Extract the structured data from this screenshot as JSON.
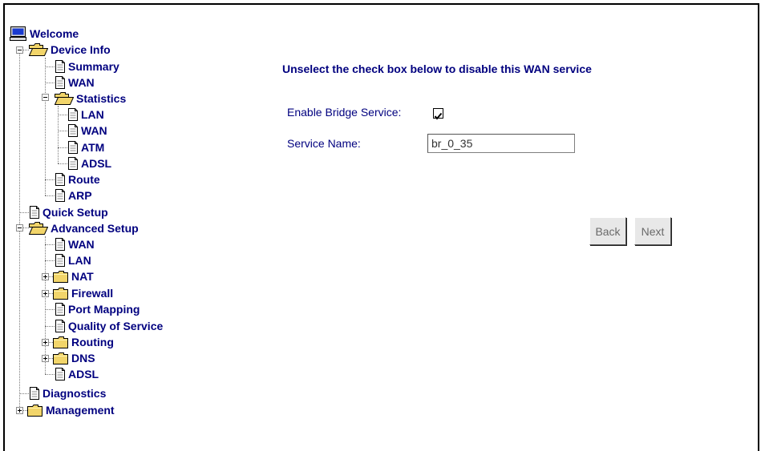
{
  "tree": {
    "welcome": "Welcome",
    "device_info": "Device Info",
    "summary": "Summary",
    "wan": "WAN",
    "statistics": "Statistics",
    "stat_lan": "LAN",
    "stat_wan": "WAN",
    "stat_atm": "ATM",
    "stat_adsl": "ADSL",
    "route": "Route",
    "arp": "ARP",
    "quick_setup": "Quick Setup",
    "advanced_setup": "Advanced Setup",
    "adv_wan": "WAN",
    "adv_lan": "LAN",
    "nat": "NAT",
    "firewall": "Firewall",
    "port_mapping": "Port Mapping",
    "qos": "Quality of Service",
    "routing": "Routing",
    "dns": "DNS",
    "adv_adsl": "ADSL",
    "diagnostics": "Diagnostics",
    "management": "Management"
  },
  "main": {
    "title": "Unselect the check box below to disable this WAN service",
    "enable_bridge_label": "Enable Bridge Service:",
    "enable_bridge_checked": true,
    "service_name_label": "Service Name:",
    "service_name_value": "br_0_35",
    "back_label": "Back",
    "next_label": "Next"
  },
  "colors": {
    "link": "#00007f",
    "folder": "#f2d56a",
    "button_text": "#6a6a6a"
  }
}
